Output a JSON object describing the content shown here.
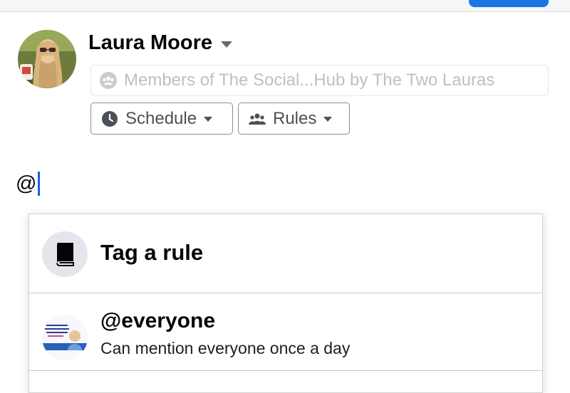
{
  "composer": {
    "author_name": "Laura Moore",
    "audience_placeholder": "Members of The Social...Hub by The Two Lauras",
    "schedule_label": "Schedule",
    "rules_label": "Rules",
    "typed_text": "@"
  },
  "mention_dropdown": {
    "header_title": "Tag a rule",
    "items": [
      {
        "title": "@everyone",
        "subtitle": "Can mention everyone once a day"
      }
    ]
  },
  "icons": {
    "audience": "group-icon",
    "schedule": "clock-icon",
    "rules": "people-icon",
    "header": "book-icon"
  },
  "colors": {
    "accent_blue": "#1b74e4",
    "cursor_blue": "#1b5be4",
    "secondary_text": "#65676b",
    "placeholder_text": "#bcc0c4"
  }
}
